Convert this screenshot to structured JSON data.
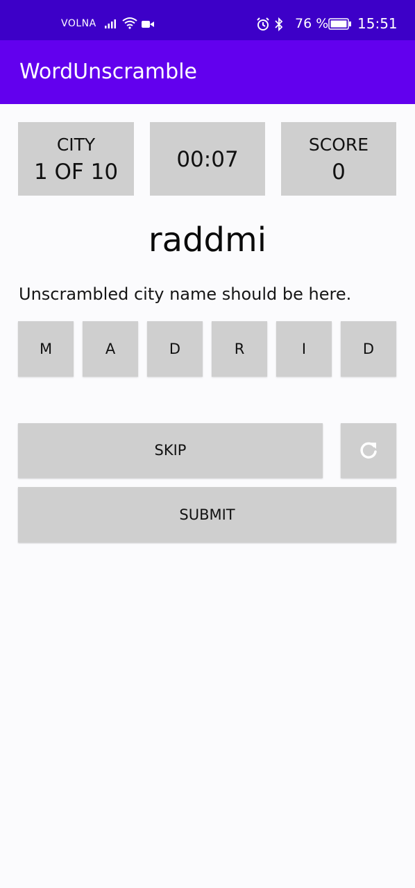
{
  "status_bar": {
    "carrier": "VOLNA",
    "battery_percent": "76 %",
    "time": "15:51",
    "icons": [
      "signal-icon",
      "wifi-icon",
      "video-icon",
      "alarm-icon",
      "bluetooth-icon",
      "battery-icon"
    ]
  },
  "app_bar": {
    "title": "WordUnscramble"
  },
  "colors": {
    "status_bar": "#3d00c8",
    "app_bar": "#6200ee",
    "card": "#cfcfcf",
    "background": "#fbfbfd"
  },
  "stats": {
    "city_label": "CITY",
    "city_value": "1 OF 10",
    "timer": "00:07",
    "score_label": "SCORE",
    "score_value": "0"
  },
  "game": {
    "scrambled_word": "raddmi",
    "hint": "Unscrambled city name should be here.",
    "letters": [
      "M",
      "A",
      "D",
      "R",
      "I",
      "D"
    ]
  },
  "actions": {
    "skip_label": "SKIP",
    "refresh_icon": "refresh-icon",
    "submit_label": "SUBMIT"
  }
}
